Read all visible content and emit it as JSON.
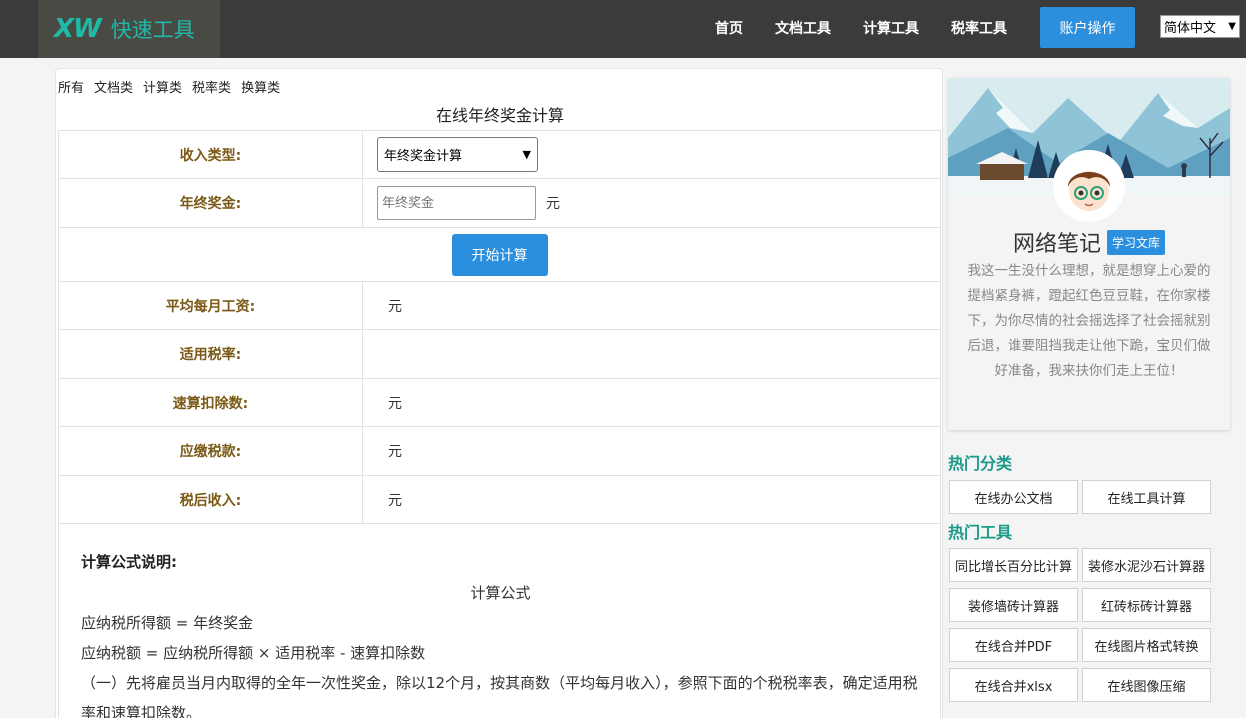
{
  "header": {
    "logo_mark": "XW",
    "logo_text": "快速工具",
    "nav": [
      "首页",
      "文档工具",
      "计算工具",
      "税率工具"
    ],
    "account_label": "账户操作",
    "language": "简体中文"
  },
  "main": {
    "categories": [
      "所有",
      "文档类",
      "计算类",
      "税率类",
      "换算类"
    ],
    "title": "在线年终奖金计算",
    "form": {
      "income_type_label": "收入类型:",
      "income_type_value": "年终奖金计算",
      "bonus_label": "年终奖金:",
      "bonus_placeholder": "年终奖金",
      "bonus_unit": "元",
      "calc_button": "开始计算"
    },
    "results": [
      {
        "label": "平均每月工资:",
        "unit": "元"
      },
      {
        "label": "适用税率:",
        "unit": ""
      },
      {
        "label": "速算扣除数:",
        "unit": "元"
      },
      {
        "label": "应缴税款:",
        "unit": "元"
      },
      {
        "label": "税后收入:",
        "unit": "元"
      }
    ],
    "formula": {
      "heading": "计算公式说明:",
      "center": "计算公式",
      "line1": "应纳税所得额 = 年终奖金",
      "line2": "应纳税额 = 应纳税所得额 × 适用税率 - 速算扣除数",
      "para": "（一）先将雇员当月内取得的全年一次性奖金，除以12个月，按其商数（平均每月收入），参照下面的个税税率表，确定适用税率和速算扣除数。"
    }
  },
  "sidebar": {
    "profile_name": "网络笔记",
    "profile_tag": "学习文库",
    "bio": "我这一生没什么理想，就是想穿上心爱的提档紧身裤，蹬起红色豆豆鞋，在你家楼下，为你尽情的社会摇选择了社会摇就别后退，谁要阻挡我走让他下跪，宝贝们做好准备，我来扶你们走上王位！",
    "hot_categories_title": "热门分类",
    "hot_categories": [
      "在线办公文档",
      "在线工具计算"
    ],
    "hot_tools_title": "热门工具",
    "hot_tools": [
      "同比增长百分比计算",
      "装修水泥沙石计算器",
      "装修墙砖计算器",
      "红砖标砖计算器",
      "在线合并PDF",
      "在线图片格式转换",
      "在线合并xlsx",
      "在线图像压缩"
    ]
  }
}
